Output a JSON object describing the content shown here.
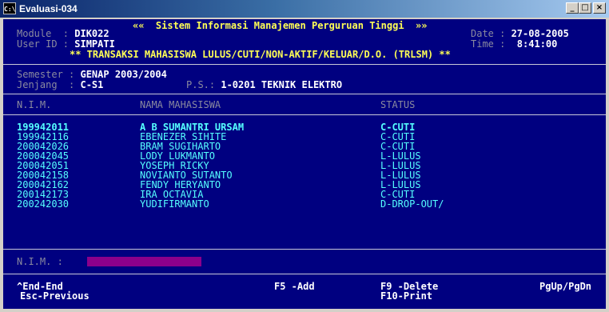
{
  "window": {
    "title": "Evaluasi-034",
    "icon_label": "C:\\",
    "controls": [
      "_",
      "□",
      "×"
    ]
  },
  "header": {
    "app_title": "««  Sistem Informasi Manajemen Perguruan Tinggi  »»",
    "module_label": "Module  : ",
    "module_value": "DIK022",
    "userid_label": "User ID : ",
    "userid_value": "SIMPATI",
    "date_label": "Date : ",
    "date_value": "27-08-2005",
    "time_label": "Time : ",
    "time_value": " 8:41:00",
    "screen_title": "** TRANSAKSI MAHASISWA LULUS/CUTI/NON-AKTIF/KELUAR/D.O. (TRLSM) **"
  },
  "filters": {
    "semester_label": "Semester : ",
    "semester_value": "GENAP 2003/2004",
    "jenjang_label": "Jenjang  : ",
    "jenjang_value": "C-S1",
    "ps_label": "P.S.: ",
    "ps_value": "1-0201 TEKNIK ELEKTRO"
  },
  "table": {
    "columns": [
      "N.I.M.",
      "NAMA MAHASISWA",
      "STATUS"
    ],
    "rows": [
      {
        "nim": "199942011",
        "nama": "A B SUMANTRI URSAM",
        "status": "C-CUTI"
      },
      {
        "nim": "199942116",
        "nama": "EBENEZER SIHITE",
        "status": "C-CUTI"
      },
      {
        "nim": "200042026",
        "nama": "BRAM SUGIHARTO",
        "status": "C-CUTI"
      },
      {
        "nim": "200042045",
        "nama": "LODY LUKMANTO",
        "status": "L-LULUS"
      },
      {
        "nim": "200042051",
        "nama": "YOSEPH RICKY",
        "status": "L-LULUS"
      },
      {
        "nim": "200042158",
        "nama": "NOVIANTO SUTANTO",
        "status": "L-LULUS"
      },
      {
        "nim": "200042162",
        "nama": "FENDY HERYANTO",
        "status": "L-LULUS"
      },
      {
        "nim": "200142173",
        "nama": "IRA OCTAVIA",
        "status": "C-CUTI"
      },
      {
        "nim": "200242030",
        "nama": "YUDIFIRMANTO",
        "status": "D-DROP-OUT/"
      }
    ]
  },
  "input": {
    "nim_label": "N.I.M. : ",
    "nim_value": ""
  },
  "footer": {
    "end_key": "^End-End",
    "esc_key": "Esc-Previous",
    "add_key": "F5 -Add",
    "delete_key": "F9 -Delete",
    "print_key": "F10-Print",
    "page_key": "PgUp/PgDn"
  },
  "colors": {
    "console_bg": "#000080",
    "highlight": "#55ffff",
    "input_bg": "#8b008b"
  }
}
